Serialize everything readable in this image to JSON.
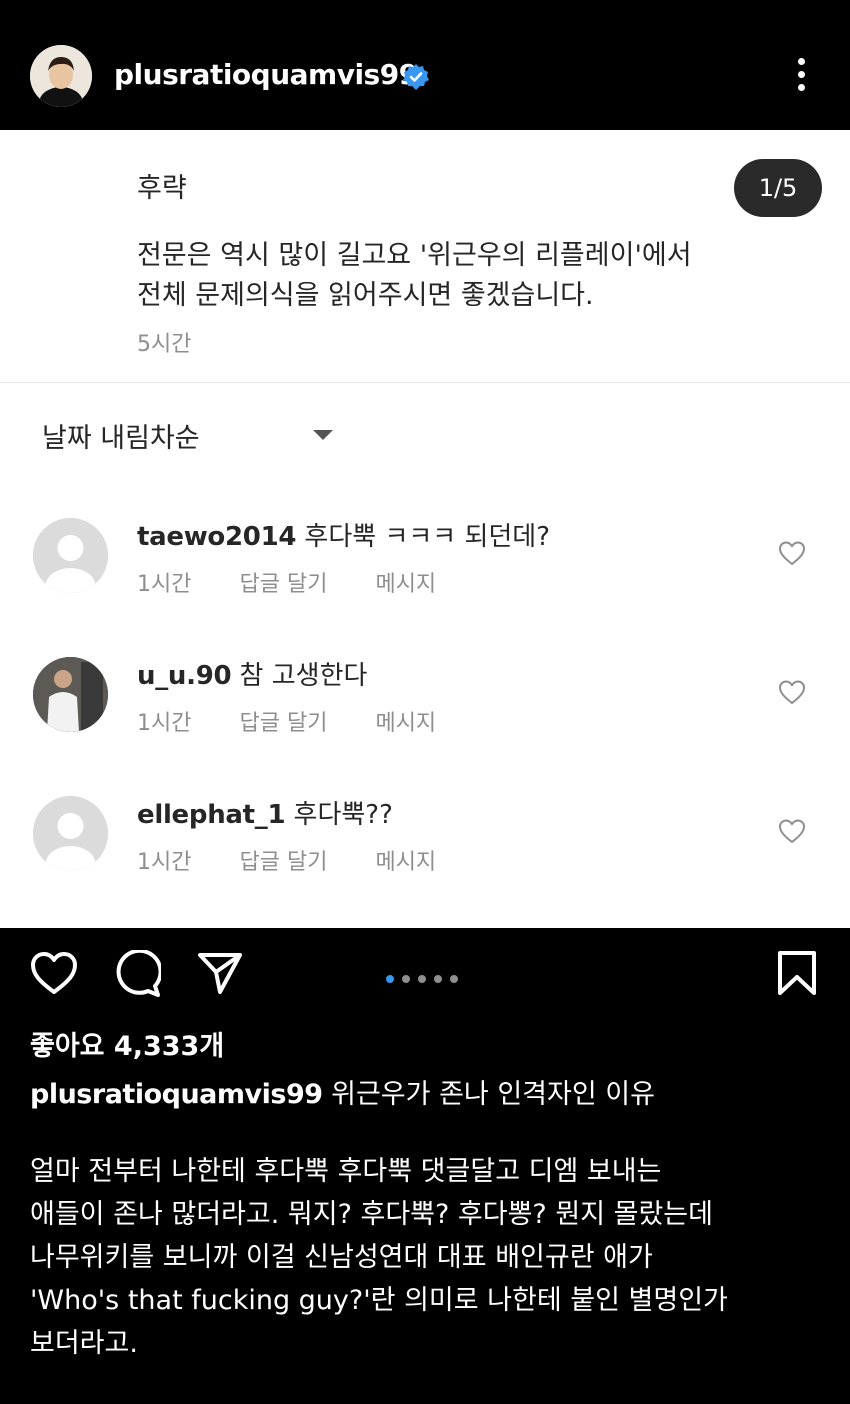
{
  "header": {
    "username": "plusratioquamvis99",
    "verified_icon": "verified-badge-icon",
    "more_icon": "more-vertical-icon"
  },
  "post_panel": {
    "caption_head": "후략",
    "page_counter": "1/5",
    "caption_body_lines": [
      "전문은 역시 많이 길고요 '위근우의 리플레이'에서",
      "전체 문제의식을 읽어주시면 좋겠습니다."
    ],
    "caption_time": "5시간",
    "sort_label": "날짜 내림차순"
  },
  "comments": [
    {
      "username": "taewo2014",
      "text": "후다뿍 ㅋㅋㅋ 되던데?",
      "time": "1시간",
      "reply": "답글 달기",
      "message": "메시지",
      "avatar": "default"
    },
    {
      "username": "u_u.90",
      "text": "참 고생한다",
      "time": "1시간",
      "reply": "답글 달기",
      "message": "메시지",
      "avatar": "photo"
    },
    {
      "username": "ellephat_1",
      "text": "후다뿍??",
      "time": "1시간",
      "reply": "답글 달기",
      "message": "메시지",
      "avatar": "default"
    }
  ],
  "actions": {
    "like_icon": "heart-icon",
    "comment_icon": "comment-icon",
    "share_icon": "send-icon",
    "save_icon": "bookmark-icon",
    "carousel_total": 5,
    "carousel_active": 1
  },
  "likes_text": "좋아요 4,333개",
  "caption": {
    "username": "plusratioquamvis99",
    "title": "위근우가 존나 인격자인 이유",
    "body_lines": [
      "얼마 전부터 나한테 후다뿍 후다뿍 댓글달고 디엠 보내는",
      "애들이 존나 많더라고. 뭐지? 후다뿍? 후다뽕? 뭔지 몰랐는데",
      "나무위키를 보니까 이걸 신남성연대 대표 배인규란 애가",
      "'Who's that fucking guy?'란 의미로 나한테 붙인 별명인가",
      "보더라고."
    ]
  },
  "colors": {
    "background": "#000000",
    "panel": "#ffffff",
    "verified": "#3897f0",
    "secondary_text": "#8e8e8e",
    "carousel_active": "#3897f0"
  }
}
